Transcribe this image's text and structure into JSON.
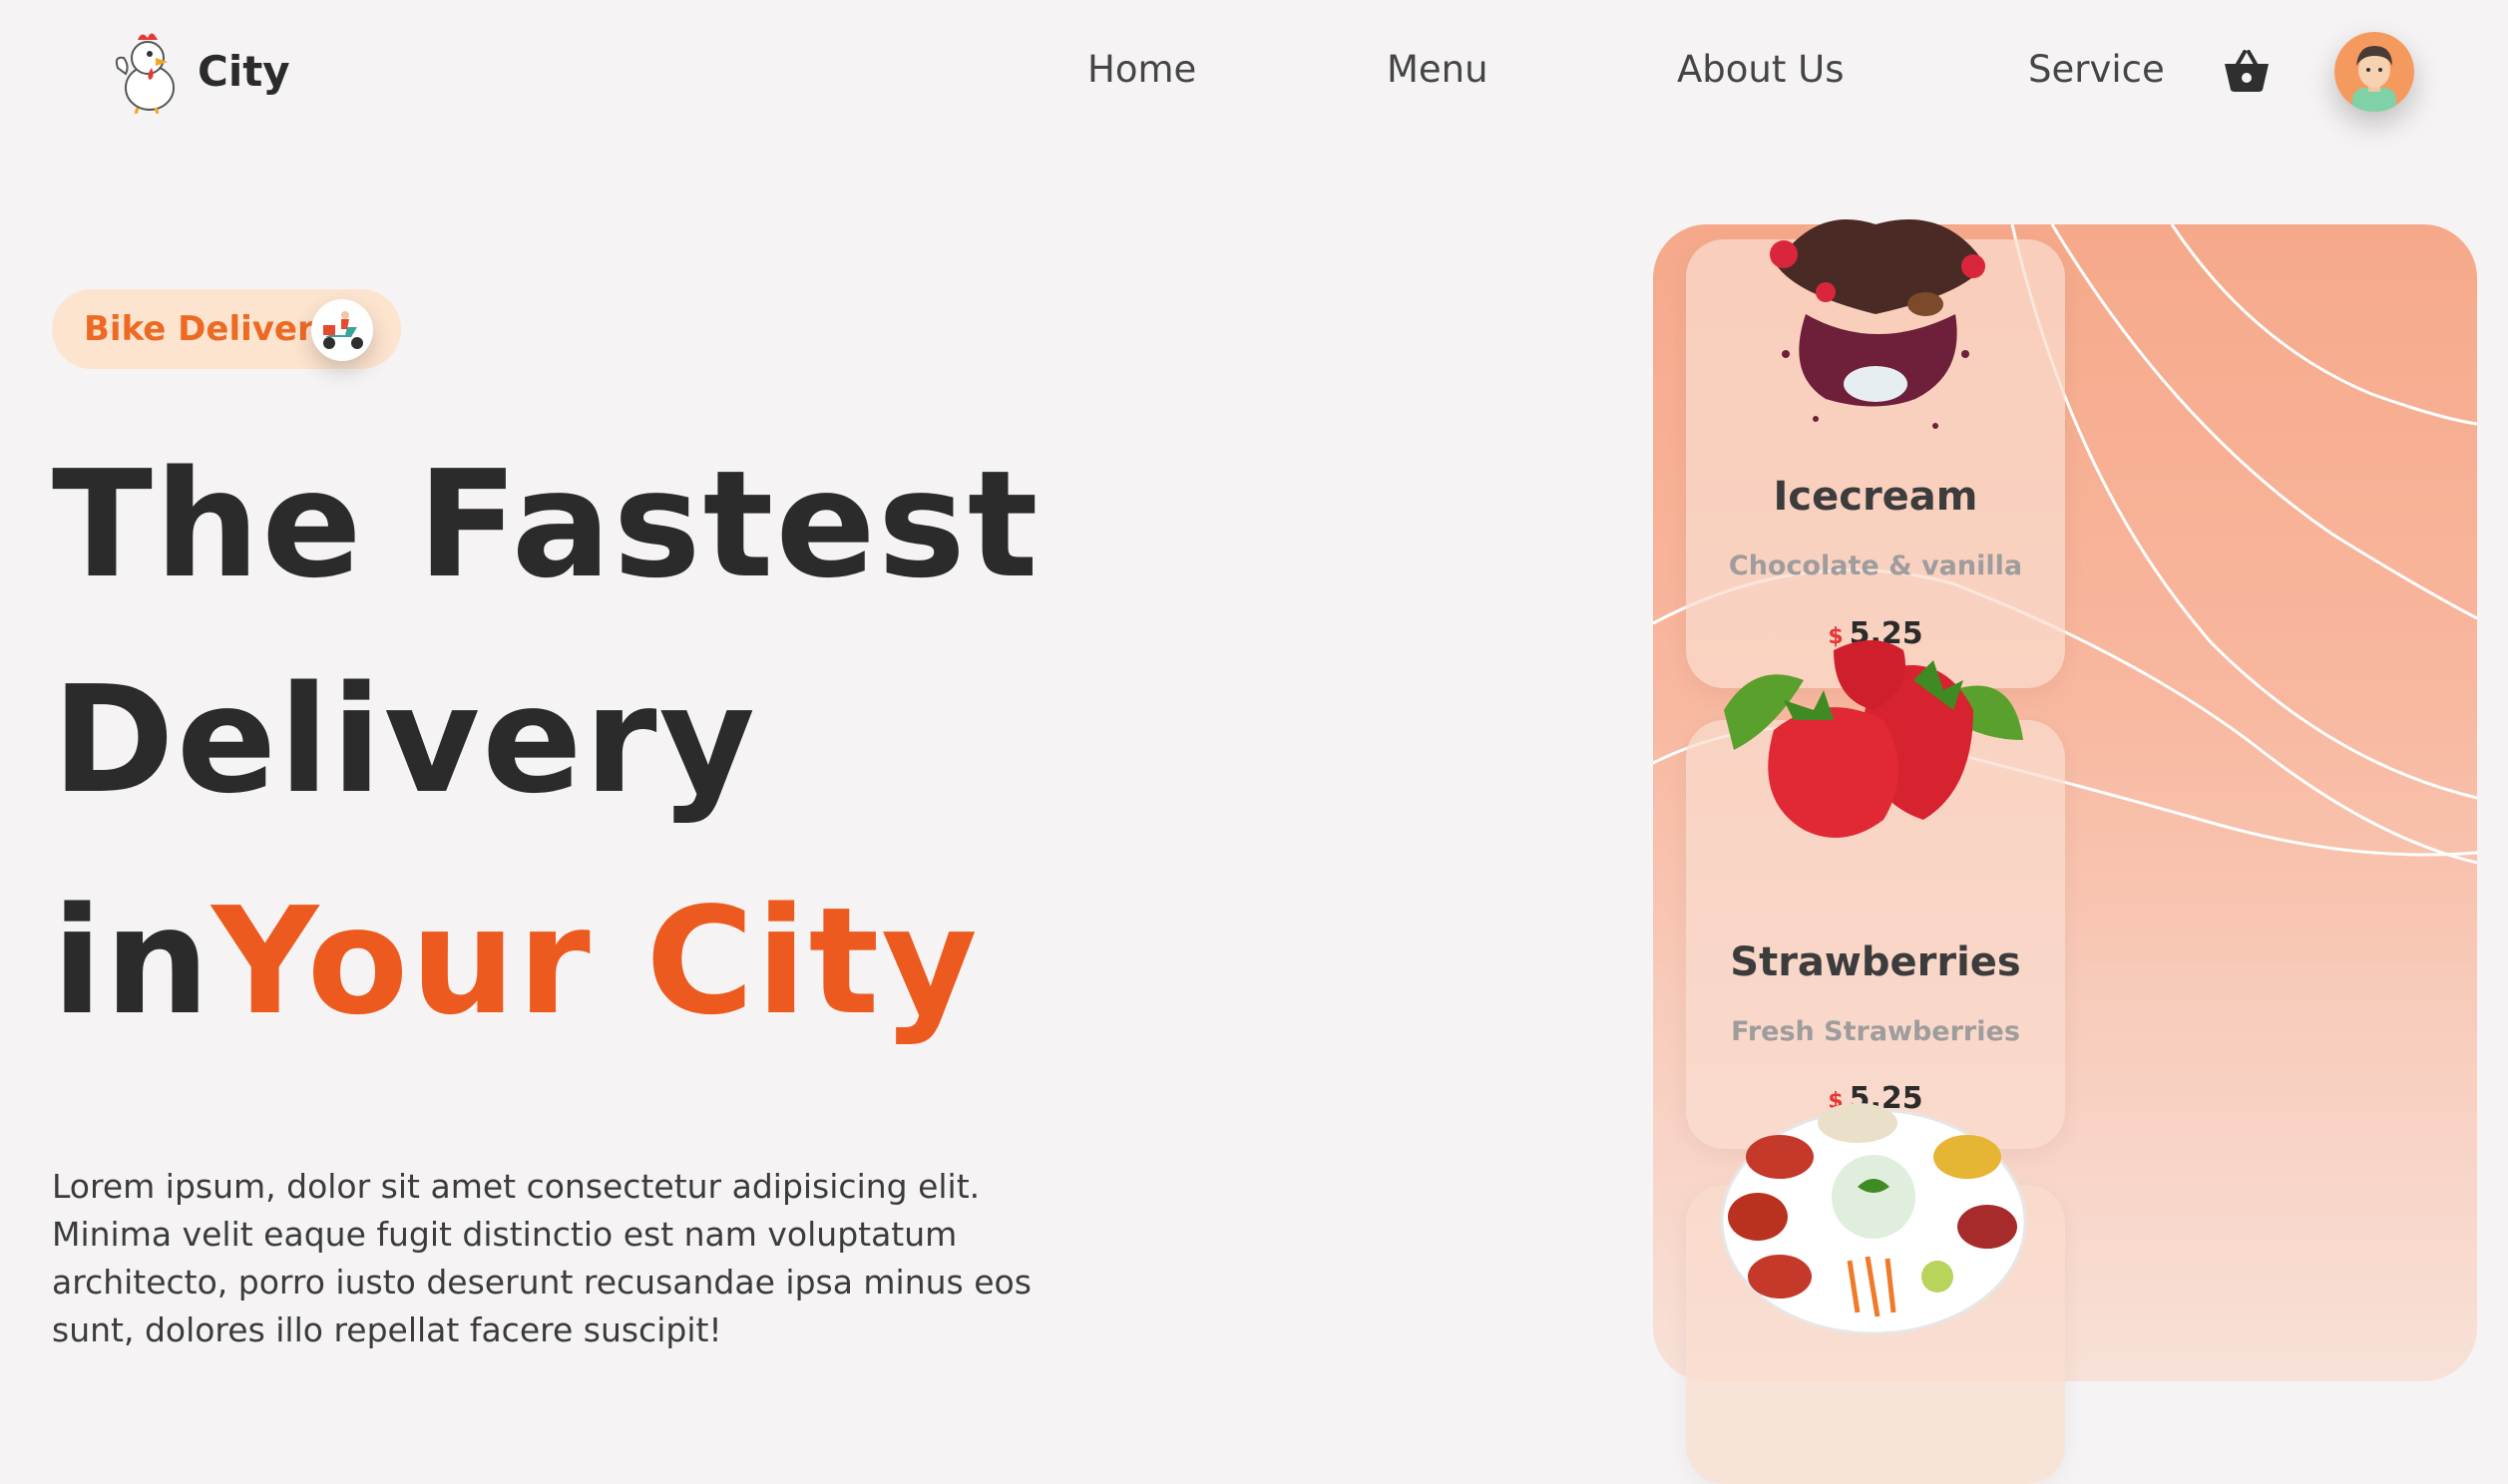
{
  "header": {
    "brand": "City",
    "nav": [
      "Home",
      "Menu",
      "About Us",
      "Service"
    ],
    "icons": [
      "basket-icon",
      "user-avatar"
    ]
  },
  "hero": {
    "badge": {
      "label": "Bike Delivery",
      "icon": "scooter-rider-icon"
    },
    "headline_line1": "The Fastest",
    "headline_line2": "Delivery",
    "headline_line3_prefix": "in",
    "headline_line3_accent": "Your City",
    "description": "Lorem ipsum, dolor sit amet consectetur adipisicing elit. Minima velit eaque fugit distinctio est nam voluptatum architecto, porro iusto deserunt recusandae ipsa minus eos sunt, dolores illo repellat facere suscipit!"
  },
  "cards": [
    {
      "title": "Icecream",
      "subtitle": "Chocolate & vanilla",
      "currency": "$",
      "price": "5.25",
      "image": "chocolate-icecream-image"
    },
    {
      "title": "Strawberries",
      "subtitle": "Fresh Strawberries",
      "currency": "$",
      "price": "5.25",
      "image": "strawberries-image"
    },
    {
      "title": "",
      "subtitle": "",
      "image": "chicken-platter-image"
    }
  ],
  "colors": {
    "accent": "#ec5a1f",
    "badge_bg": "#fde4cf",
    "panel_top": "#f6a98a",
    "background": "#f5f3f3",
    "text": "#2b2b2b"
  }
}
